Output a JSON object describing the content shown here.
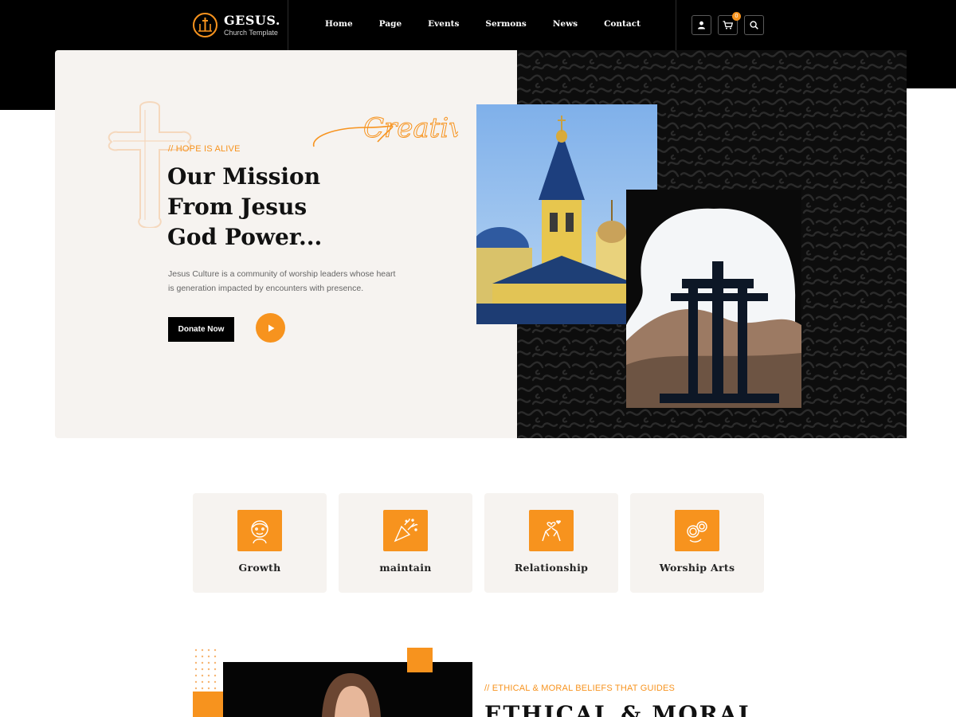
{
  "brand": {
    "name": "GESUS.",
    "subtitle": "Church Template",
    "accent": "#f7931e",
    "dark": "#000000"
  },
  "nav": {
    "items": [
      "Home",
      "Page",
      "Events",
      "Sermons",
      "News",
      "Contact"
    ]
  },
  "header_icons": {
    "user": "user-icon",
    "cart": "cart-icon",
    "cart_count": "0",
    "search": "search-icon"
  },
  "hero": {
    "tagline": "// HOPE IS ALIVE",
    "title_lines": [
      "Our Mission",
      "From Jesus",
      "God Power..."
    ],
    "description": "Jesus Culture is a community of worship leaders whose heart is generation impacted by encounters with presence.",
    "donate_label": "Donate Now",
    "script_word": "Creative"
  },
  "features": [
    {
      "label": "Growth",
      "icon": "face-icon"
    },
    {
      "label": "maintain",
      "icon": "party-popper-icon"
    },
    {
      "label": "Relationship",
      "icon": "hands-heart-icon"
    },
    {
      "label": "Worship Arts",
      "icon": "rings-icon"
    }
  ],
  "about": {
    "tagline": "// ETHICAL & MORAL BELIEFS THAT GUIDES",
    "title": "ETHICAL & MORAL"
  }
}
